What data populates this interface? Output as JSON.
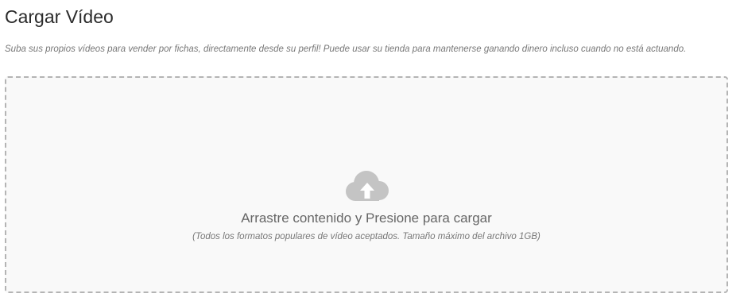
{
  "header": {
    "title": "Cargar Vídeo"
  },
  "intro": {
    "description": "Suba sus propios vídeos para vender por fichas, directamente desde su perfil! Puede usar su tienda para mantenerse ganando dinero incluso cuando no está actuando."
  },
  "dropzone": {
    "icon": "cloud-upload-icon",
    "message": "Arrastre contenido y Presione para cargar",
    "hint": "(Todos los formatos populares de vídeo aceptados. Tamaño máximo del archivo 1GB)",
    "colors": {
      "border": "#b4b4b4",
      "background": "#f9f9f9",
      "icon": "#c4c4c4"
    }
  }
}
